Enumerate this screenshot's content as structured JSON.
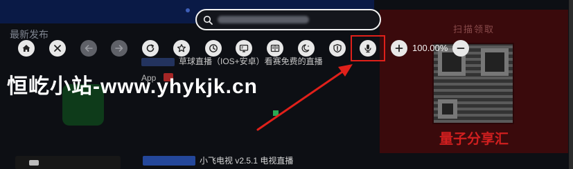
{
  "background": {
    "section_title": "最新发布",
    "app_row_title": "草球直播（IOS+安卓）看赛免费的直播",
    "app_name": "App",
    "version_text": "",
    "bottom_tag": "",
    "bottom_title": "小飞电视 v2.5.1 电视直播"
  },
  "promo": {
    "header": "扫描领取",
    "footer": "量子分享汇"
  },
  "urlbar": {
    "value": "",
    "placeholder": ""
  },
  "toolbar": {
    "buttons": [
      {
        "name": "home",
        "icon": "home-icon"
      },
      {
        "name": "close",
        "icon": "close-icon"
      },
      {
        "name": "back",
        "icon": "arrow-left-icon"
      },
      {
        "name": "forward",
        "icon": "arrow-right-icon"
      },
      {
        "name": "refresh",
        "icon": "refresh-icon"
      },
      {
        "name": "bookmark",
        "icon": "star-icon"
      },
      {
        "name": "history",
        "icon": "clock-icon"
      },
      {
        "name": "desktop-mode",
        "icon": "desktop-icon"
      },
      {
        "name": "reader-mode",
        "icon": "book-icon"
      },
      {
        "name": "night-mode",
        "icon": "moon-icon"
      },
      {
        "name": "adblock",
        "icon": "shield-icon"
      },
      {
        "name": "voice-search",
        "icon": "microphone-icon"
      },
      {
        "name": "zoom-in",
        "icon": "plus-icon"
      },
      {
        "name": "zoom-out",
        "icon": "minus-icon"
      }
    ],
    "zoom_level": "100.00%"
  },
  "watermark": "恒屹小站-www.yhykjk.cn",
  "colors": {
    "highlight": "#e0201a",
    "toolbar_button": "#e8e8e8",
    "toolbar_button_disabled": "#5f6168",
    "accent_red": "#d11f1f"
  }
}
